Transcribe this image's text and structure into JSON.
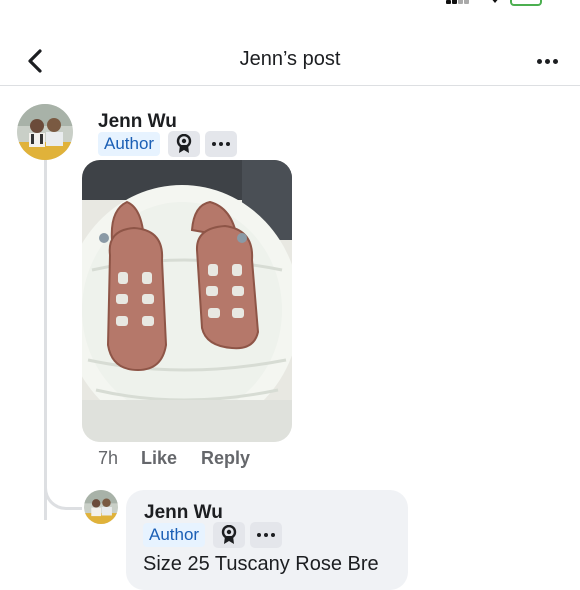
{
  "header": {
    "title": "Jenn’s post"
  },
  "comment": {
    "author_name": "Jenn Wu",
    "author_badge": "Author",
    "timestamp": "7h",
    "like_label": "Like",
    "reply_label": "Reply"
  },
  "reply": {
    "author_name": "Jenn Wu",
    "author_badge": "Author",
    "text": "Size 25 Tuscany Rose Bre"
  },
  "colors": {
    "author_badge_bg": "#e7f3ff",
    "author_badge_text": "#1b5fb5",
    "bubble_bg": "#f0f2f5",
    "sandal": "#b5786a"
  },
  "icons": {
    "back": "chevron-left-icon",
    "more": "more-horizontal-icon",
    "badge": "award-ribbon-icon"
  }
}
